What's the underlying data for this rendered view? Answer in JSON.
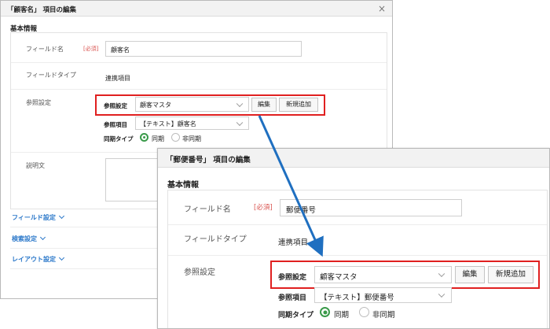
{
  "dialog1": {
    "title": "「顧客名」 項目の編集",
    "section": "基本情報",
    "field_name_label": "フィールド名",
    "required_badge": "[必須]",
    "field_name_value": "顧客名",
    "field_type_label": "フィールドタイプ",
    "field_type_value": "連携項目",
    "ref_settings_label": "参照設定",
    "ref_label": "参照設定",
    "ref_value": "顧客マスタ",
    "edit_button": "編集",
    "add_button": "新規追加",
    "ref_item_label": "参照項目",
    "ref_item_value": "【テキスト】顧客名",
    "sync_type_label": "同期タイプ",
    "sync_option": "同期",
    "async_option": "非同期",
    "description_label": "説明文",
    "field_settings": "フィールド設定",
    "search_settings": "検索設定",
    "layout_settings": "レイアウト設定"
  },
  "dialog2": {
    "title": "「郵便番号」 項目の編集",
    "section": "基本情報",
    "field_name_label": "フィールド名",
    "required_badge": "[必須]",
    "field_name_value": "郵便番号",
    "field_type_label": "フィールドタイプ",
    "field_type_value": "連携項目",
    "ref_settings_label": "参照設定",
    "ref_label": "参照設定",
    "ref_value": "顧客マスタ",
    "edit_button": "編集",
    "add_button": "新規追加",
    "ref_item_label": "参照項目",
    "ref_item_value": "【テキスト】郵便番号",
    "sync_type_label": "同期タイプ",
    "sync_option": "同期",
    "async_option": "非同期"
  },
  "colors": {
    "highlight": "#e02020",
    "arrow": "#1f6fc0",
    "radio_selected": "#3a9a4a",
    "link": "#2a77c9"
  }
}
